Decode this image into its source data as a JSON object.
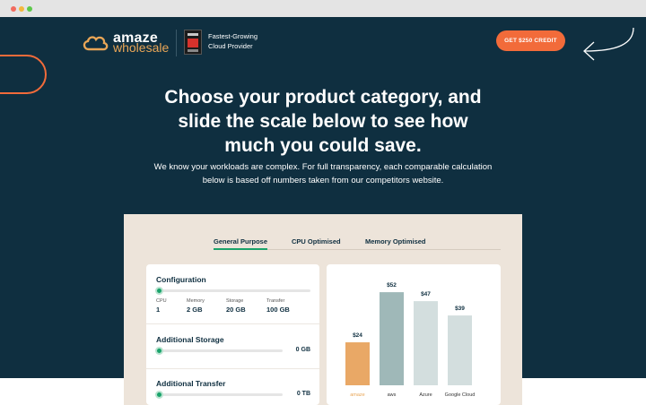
{
  "header": {
    "logo_top": "amaze",
    "logo_bottom": "wholesale",
    "award_line1": "Fastest-Growing",
    "award_line2": "Cloud Provider",
    "cta_label": "GET $250 CREDIT"
  },
  "hero": {
    "headline_line1": "Choose your product category, and",
    "headline_line2": "slide the scale below to see how",
    "headline_line3": "much you could save.",
    "sub_line1": "We know your workloads are complex. For full transparency, each comparable calculation",
    "sub_line2": "below is based off numbers taken from our competitors website."
  },
  "tabs": [
    {
      "label": "General Purpose",
      "active": true
    },
    {
      "label": "CPU Optimised",
      "active": false
    },
    {
      "label": "Memory Optimised",
      "active": false
    }
  ],
  "configuration": {
    "title": "Configuration",
    "level": 0,
    "specs": [
      {
        "label": "CPU",
        "value": "1"
      },
      {
        "label": "Memory",
        "value": "2 GB"
      },
      {
        "label": "Storage",
        "value": "20 GB"
      },
      {
        "label": "Transfer",
        "value": "100 GB"
      }
    ]
  },
  "additional_storage": {
    "title": "Additional Storage",
    "value": "0 GB",
    "level": 0
  },
  "additional_transfer": {
    "title": "Additional Transfer",
    "value": "0 TB",
    "level": 0
  },
  "chart_data": {
    "type": "bar",
    "categories": [
      "amaze",
      "aws",
      "Azure",
      "Google Cloud"
    ],
    "values": [
      24,
      52,
      47,
      39
    ],
    "labels": [
      "$24",
      "$52",
      "$47",
      "$39"
    ],
    "colors": [
      "#e9a866",
      "#9fb8b8",
      "#d3dede",
      "#d3dede"
    ],
    "ylim": [
      0,
      60
    ],
    "title": "",
    "xlabel": "",
    "ylabel": ""
  },
  "colors": {
    "navy": "#0f2f40",
    "orange": "#f26b3a",
    "green": "#1aa36b",
    "panel": "#ede4da"
  }
}
